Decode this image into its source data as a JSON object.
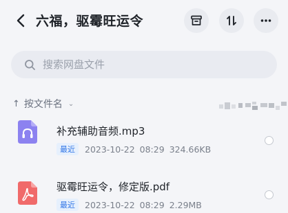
{
  "header": {
    "title": "六福，驱霉旺运令",
    "back_icon": "chevron-left-icon",
    "actions": [
      "archive-icon",
      "sort-toggle-icon",
      "more-icon"
    ]
  },
  "search": {
    "placeholder": "搜索网盘文件",
    "value": ""
  },
  "sort": {
    "label": "按文件名",
    "arrow": "↑",
    "chevron": "⌄"
  },
  "files": [
    {
      "name": "补充辅助音频.mp3",
      "badge": "最近",
      "date": "2023-10-22",
      "time": "08:29",
      "size": "324.66KB",
      "icon": "audio-file-icon",
      "icon_color": "#8c82f0"
    },
    {
      "name": "驱霉旺运令，修定版.pdf",
      "badge": "最近",
      "date": "2023-10-22",
      "time": "08:29",
      "size": "2.29MB",
      "icon": "pdf-file-icon",
      "icon_color": "#f06a6a"
    }
  ],
  "colors": {
    "background": "#f4f5f8",
    "accent": "#2f74e6",
    "badge_bg": "#e6f0fd"
  }
}
